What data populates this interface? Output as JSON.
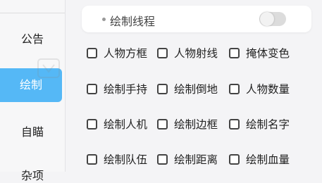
{
  "sidebar": {
    "items": [
      {
        "label": "公告",
        "active": false
      },
      {
        "label": "绘制",
        "active": true
      },
      {
        "label": "自瞄",
        "active": false
      },
      {
        "label": "杂项",
        "active": false
      }
    ]
  },
  "colors": {
    "accent": "#55b8f6",
    "background": "#f4f4f6",
    "card": "#ffffff"
  },
  "header": {
    "label": "绘制线程",
    "toggle_on": false
  },
  "options": [
    {
      "label": "人物方框",
      "checked": false
    },
    {
      "label": "人物射线",
      "checked": false
    },
    {
      "label": "掩体变色",
      "checked": false
    },
    {
      "label": "绘制手持",
      "checked": false
    },
    {
      "label": "绘制倒地",
      "checked": false
    },
    {
      "label": "人物数量",
      "checked": false
    },
    {
      "label": "绘制人机",
      "checked": false
    },
    {
      "label": "绘制边框",
      "checked": false
    },
    {
      "label": "绘制名字",
      "checked": false
    },
    {
      "label": "绘制队伍",
      "checked": false
    },
    {
      "label": "绘制距离",
      "checked": false
    },
    {
      "label": "绘制血量",
      "checked": false
    }
  ]
}
